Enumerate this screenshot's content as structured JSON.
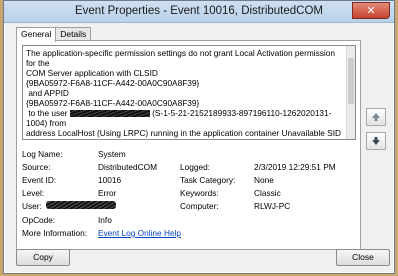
{
  "window": {
    "title": "Event Properties - Event 10016, DistributedCOM",
    "close_glyph": "✕"
  },
  "tabs": [
    {
      "label": "General"
    },
    {
      "label": "Details"
    }
  ],
  "description": {
    "line1": "The application-specific permission settings do not grant Local Activation permission for the",
    "line2": "COM Server application with CLSID",
    "line3": "{9BA05972-F6A8-11CF-A442-00A0C90A8F39}",
    "line4": " and APPID",
    "line5": "{9BA05972-F6A8-11CF-A442-00A0C90A8F39}",
    "line6_pre": " to the user ",
    "line6_post": " (S-1-5-21-2152189933-897196110-1262020131-1004) from",
    "line7": "address LocalHost (Using LRPC) running in the application container Unavailable SID"
  },
  "fields": {
    "log_name_label": "Log Name:",
    "log_name": "System",
    "source_label": "Source:",
    "source": "DistributedCOM",
    "logged_label": "Logged:",
    "logged": "2/3/2019 12:29:51 PM",
    "event_id_label": "Event ID:",
    "event_id": "10016",
    "task_category_label": "Task Category:",
    "task_category": "None",
    "level_label": "Level:",
    "level": "Error",
    "keywords_label": "Keywords:",
    "keywords": "Classic",
    "user_label": "User:",
    "computer_label": "Computer:",
    "computer": "RLWJ-PC",
    "opcode_label": "OpCode:",
    "opcode": "Info",
    "more_info_label": "More Information:",
    "more_info_link": "Event Log Online Help"
  },
  "buttons": {
    "copy": "Copy",
    "close": "Close"
  },
  "side_icons": {
    "up": "up-arrow-icon",
    "down": "down-arrow-icon"
  }
}
